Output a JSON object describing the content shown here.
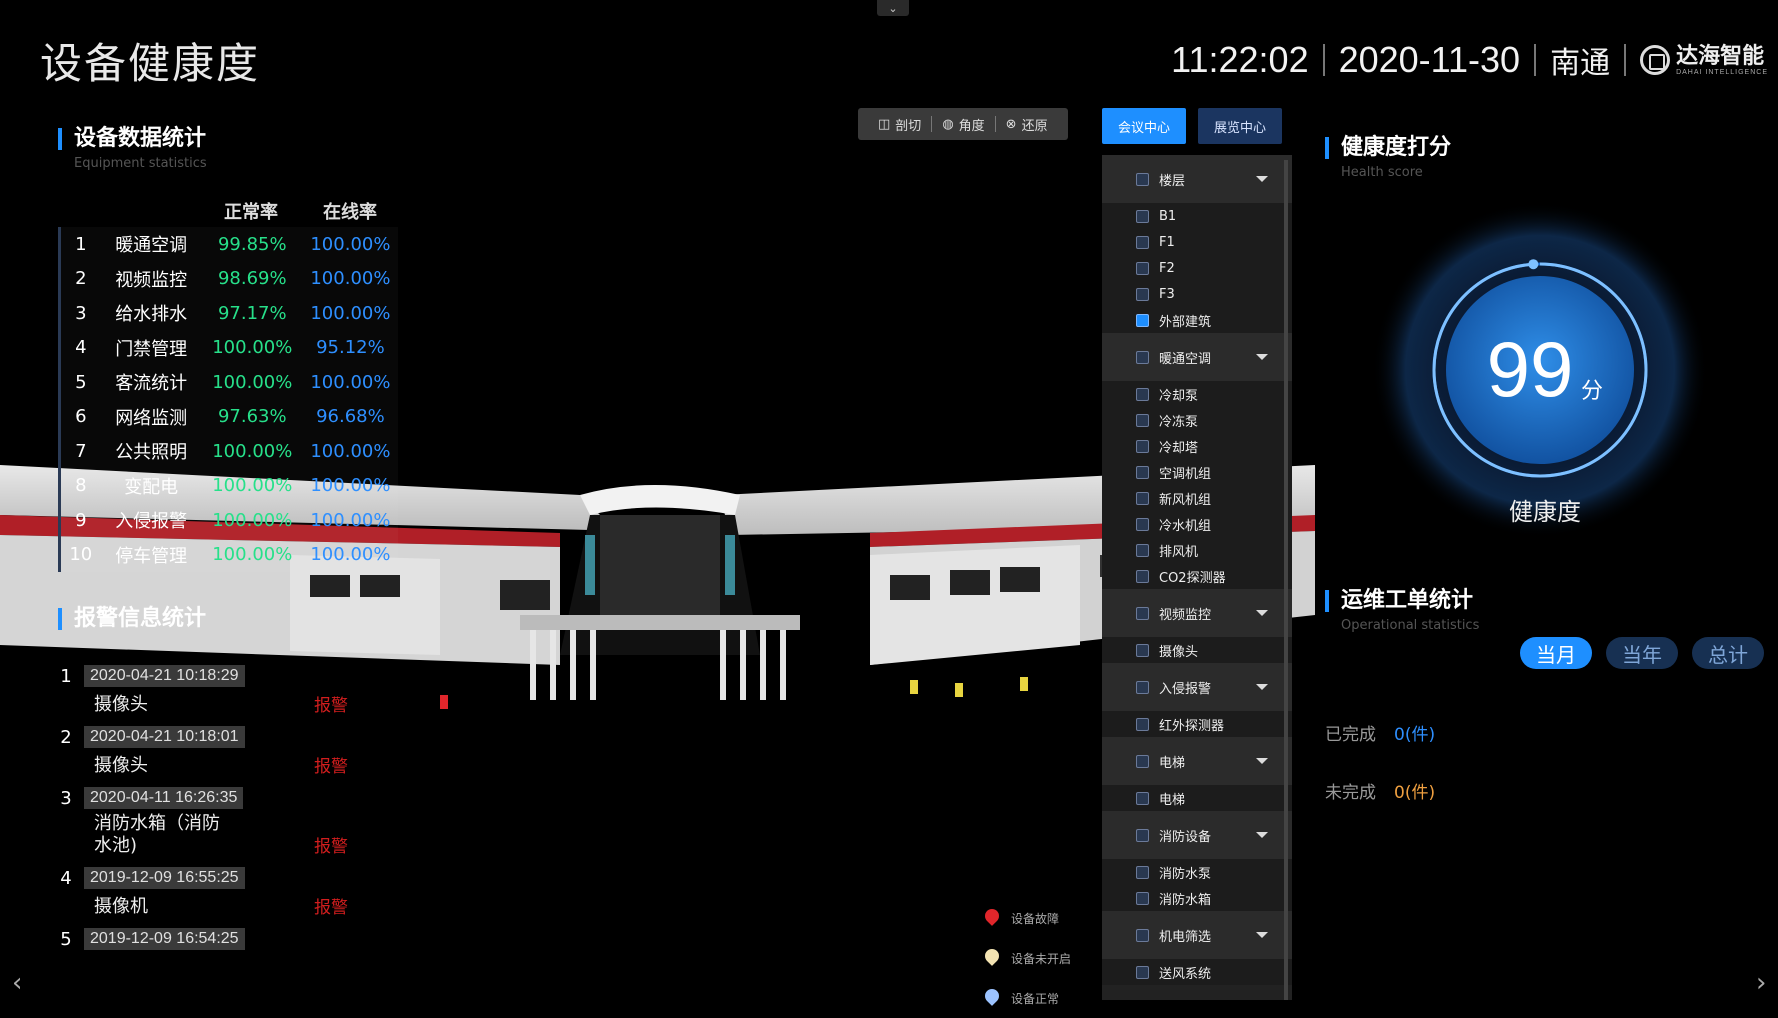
{
  "header": {
    "title": "设备健康度",
    "time": "11:22:02",
    "date": "2020-11-30",
    "city": "南通",
    "logo_cn": "达海智能",
    "logo_en": "DAHAI INTELLIGENCE"
  },
  "stats": {
    "title": "设备数据统计",
    "subtitle": "Equipment statistics",
    "col_normal": "正常率",
    "col_online": "在线率",
    "rows": [
      {
        "idx": "1",
        "name": "暖通空调",
        "normal": "99.85%",
        "online": "100.00%"
      },
      {
        "idx": "2",
        "name": "视频监控",
        "normal": "98.69%",
        "online": "100.00%"
      },
      {
        "idx": "3",
        "name": "给水排水",
        "normal": "97.17%",
        "online": "100.00%"
      },
      {
        "idx": "4",
        "name": "门禁管理",
        "normal": "100.00%",
        "online": "95.12%"
      },
      {
        "idx": "5",
        "name": "客流统计",
        "normal": "100.00%",
        "online": "100.00%"
      },
      {
        "idx": "6",
        "name": "网络监测",
        "normal": "97.63%",
        "online": "96.68%"
      },
      {
        "idx": "7",
        "name": "公共照明",
        "normal": "100.00%",
        "online": "100.00%"
      },
      {
        "idx": "8",
        "name": "变配电",
        "normal": "100.00%",
        "online": "100.00%"
      },
      {
        "idx": "9",
        "name": "入侵报警",
        "normal": "100.00%",
        "online": "100.00%"
      },
      {
        "idx": "10",
        "name": "停车管理",
        "normal": "100.00%",
        "online": "100.00%"
      }
    ]
  },
  "alarms": {
    "title": "报警信息统计",
    "items": [
      {
        "idx": "1",
        "time": "2020-04-21 10:18:29",
        "device": "摄像头",
        "status": "报警"
      },
      {
        "idx": "2",
        "time": "2020-04-21 10:18:01",
        "device": "摄像头",
        "status": "报警"
      },
      {
        "idx": "3",
        "time": "2020-04-11 16:26:35",
        "device": "消防水箱（消防水池)",
        "status": "报警"
      },
      {
        "idx": "4",
        "time": "2019-12-09 16:55:25",
        "device": "摄像机",
        "status": "报警"
      },
      {
        "idx": "5",
        "time": "2019-12-09 16:54:25",
        "device": "",
        "status": ""
      }
    ]
  },
  "toolbar": {
    "cut": "剖切",
    "angle": "角度",
    "restore": "还原"
  },
  "tabs": {
    "meeting": "会议中心",
    "exhibition": "展览中心"
  },
  "filter": {
    "groups": [
      {
        "label": "楼层",
        "items": [
          "B1",
          "F1",
          "F2",
          "F3",
          "外部建筑"
        ],
        "checked": [
          false,
          false,
          false,
          false,
          true
        ]
      },
      {
        "label": "暖通空调",
        "items": [
          "冷却泵",
          "冷冻泵",
          "冷却塔",
          "空调机组",
          "新风机组",
          "冷水机组",
          "排风机",
          "CO2探测器"
        ],
        "checked": [
          false,
          false,
          false,
          false,
          false,
          false,
          false,
          false
        ]
      },
      {
        "label": "视频监控",
        "items": [
          "摄像头"
        ],
        "checked": [
          false
        ]
      },
      {
        "label": "入侵报警",
        "items": [
          "红外探测器"
        ],
        "checked": [
          false
        ]
      },
      {
        "label": "电梯",
        "items": [
          "电梯"
        ],
        "checked": [
          false
        ]
      },
      {
        "label": "消防设备",
        "items": [
          "消防水泵",
          "消防水箱"
        ],
        "checked": [
          false,
          false
        ]
      },
      {
        "label": "机电筛选",
        "items": [
          "送风系统"
        ],
        "checked": [
          false
        ]
      }
    ]
  },
  "legend": {
    "fault": "设备故障",
    "off": "设备未开启",
    "normal": "设备正常"
  },
  "health": {
    "title": "健康度打分",
    "subtitle": "Health score",
    "score": "99",
    "unit": "分",
    "label": "健康度",
    "score_fraction": 0.99
  },
  "ops": {
    "title": "运维工单统计",
    "subtitle": "Operational statistics",
    "pills": [
      "当月",
      "当年",
      "总计"
    ],
    "done_label": "已完成",
    "done_value": "0(件)",
    "todo_label": "未完成",
    "todo_value": "0(件)"
  },
  "colors": {
    "accent": "#1e8fff",
    "normal_rate": "#27e08a",
    "online_rate": "#2e8fff",
    "alarm": "#d21e1e",
    "todo": "#f0a040"
  }
}
